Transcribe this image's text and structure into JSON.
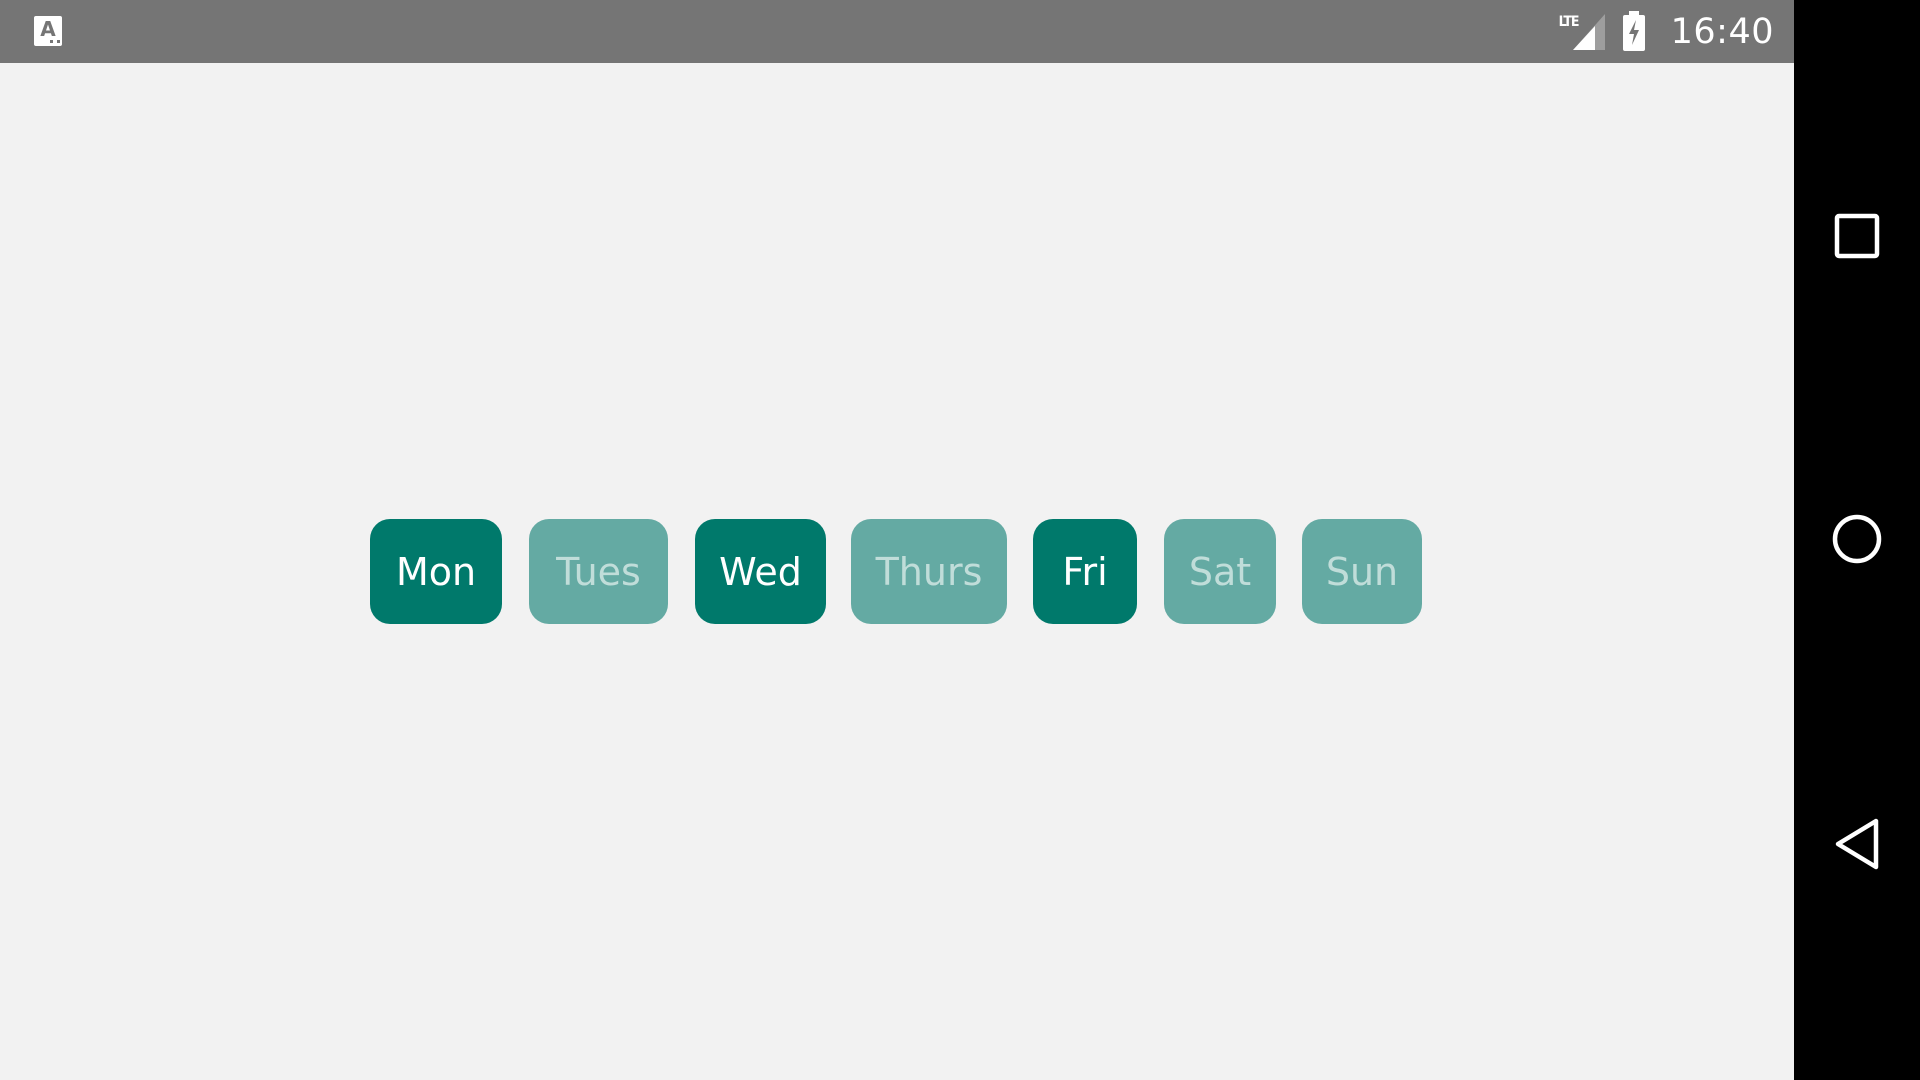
{
  "status_bar": {
    "app_icon": "text-input-app-icon",
    "network_label": "LTE",
    "signal_icon": "cell-signal-icon",
    "battery_icon": "battery-charging-icon",
    "time": "16:40"
  },
  "day_picker": {
    "days": [
      {
        "label": "Mon",
        "selected": true
      },
      {
        "label": "Tues",
        "selected": false
      },
      {
        "label": "Wed",
        "selected": true
      },
      {
        "label": "Thurs",
        "selected": false
      },
      {
        "label": "Fri",
        "selected": true
      },
      {
        "label": "Sat",
        "selected": false
      },
      {
        "label": "Sun",
        "selected": false
      }
    ]
  },
  "nav_bar": {
    "recents_icon": "recents-square-icon",
    "home_icon": "home-circle-icon",
    "back_icon": "back-triangle-icon"
  },
  "colors": {
    "selected_chip": "#00796b",
    "unselected_chip": "#64aaa3",
    "background": "#f2f2f2",
    "status_bar": "#757575",
    "nav_bar": "#000000"
  }
}
